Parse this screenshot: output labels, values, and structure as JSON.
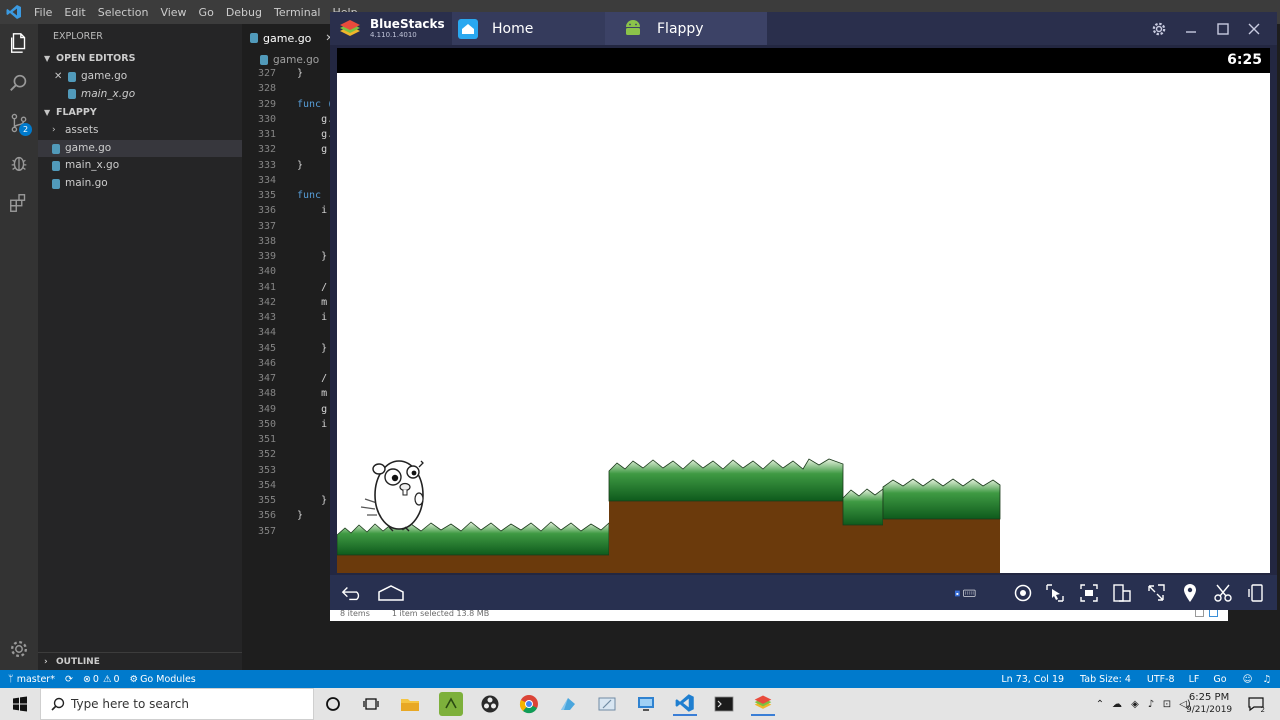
{
  "vscode": {
    "menu": [
      "File",
      "Edit",
      "Selection",
      "View",
      "Go",
      "Debug",
      "Terminal",
      "Help"
    ],
    "scm_badge": "2",
    "explorer": {
      "title": "EXPLORER",
      "open_editors_label": "OPEN EDITORS",
      "open_editors": [
        "game.go",
        "main_x.go"
      ],
      "project_label": "FLAPPY",
      "files": [
        "assets",
        "game.go",
        "main_x.go",
        "main.go"
      ],
      "outline_label": "OUTLINE"
    },
    "tab_label": "game.go",
    "breadcrumb": "game.go",
    "line_numbers": [
      "327",
      "328",
      "329",
      "330",
      "331",
      "332",
      "333",
      "334",
      "335",
      "336",
      "337",
      "338",
      "339",
      "340",
      "341",
      "342",
      "343",
      "344",
      "345",
      "346",
      "347",
      "348",
      "349",
      "350",
      "351",
      "352",
      "353",
      "354",
      "355",
      "356",
      "357"
    ],
    "code_lines": [
      "}",
      "",
      "func (",
      "    g.",
      "    g.",
      "    g",
      "}",
      "",
      "func ",
      "    i",
      "",
      "",
      "    }",
      "",
      "    /",
      "    m",
      "    i",
      "",
      "    }",
      "",
      "    /",
      "    m",
      "    g",
      "    i",
      "",
      "",
      "",
      "",
      "    }",
      "}",
      ""
    ]
  },
  "statusbar": {
    "branch": "master*",
    "errors": "0",
    "warnings": "0",
    "go_modules": "Go Modules",
    "position": "Ln 73, Col 19",
    "tab_size": "Tab Size: 4",
    "encoding": "UTF-8",
    "eol": "LF",
    "language": "Go"
  },
  "bluestacks": {
    "app_name": "BlueStacks",
    "version": "4.110.1.4010",
    "tabs": [
      "Home",
      "Flappy"
    ],
    "clock": "6:25"
  },
  "explorer_strip": {
    "items": "8 items",
    "selected": "1 item selected  13.8 MB"
  },
  "taskbar": {
    "search_placeholder": "Type here to search",
    "time": "6:25 PM",
    "date": "9/21/2019",
    "notifications": "2"
  },
  "colors": {
    "vscode_blue": "#007acc",
    "bluestacks_bg": "#232741",
    "grass": "#2e8b3a",
    "dirt": "#6b3a0c"
  }
}
